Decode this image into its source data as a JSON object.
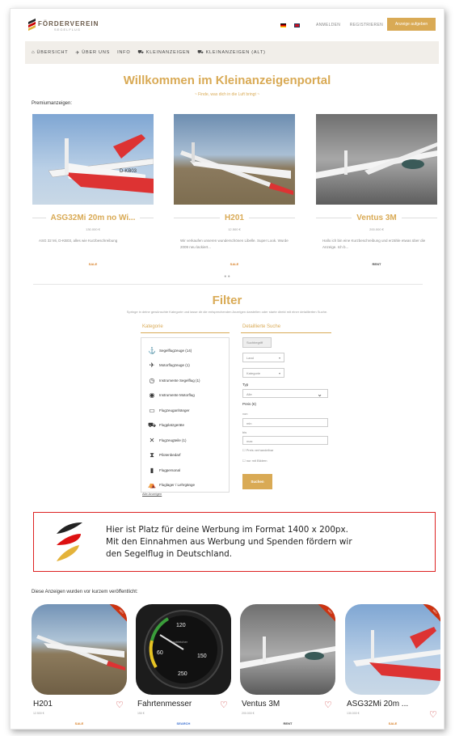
{
  "header": {
    "logo_text": "FÖRDERVEREIN",
    "logo_sub": "SEGELFLUG",
    "login": "ANMELDEN",
    "register": "REGISTRIEREN",
    "cta": "Anzeige aufgeben"
  },
  "nav": [
    {
      "label": "ÜBERSICHT",
      "icon": "home-icon"
    },
    {
      "label": "ÜBER UNS",
      "icon": "plane-icon"
    },
    {
      "label": "INFO",
      "icon": ""
    },
    {
      "label": "KLEINANZEIGEN",
      "icon": "cart-icon"
    },
    {
      "label": "KLEINANZEIGEN (ALT)",
      "icon": "cart-icon"
    }
  ],
  "welcome": {
    "title": "Willkommen im Kleinanzeigenportal",
    "subtitle": "~ Finde, was dich in die Luft bringt ~"
  },
  "premium": {
    "label": "Premiumanzeigen:",
    "cards": [
      {
        "title": "ASG32Mi 20m no Wi...",
        "price": "130.000 €",
        "desc": "ASG 32 Mi, D-KB03, alles wie Kurzbeschreibung",
        "tag": "SALE",
        "tag_color": "#d9822b"
      },
      {
        "title": "H201",
        "price": "12.500 €",
        "desc": "Wir verkaufen unseren wunderschönen Libelle. Super Look. Wurde 2009 neu lackiert...",
        "tag": "SALE",
        "tag_color": "#d9822b"
      },
      {
        "title": "Ventus 3M",
        "price": "200.000 €",
        "desc": "Hallo ich bin eine Kurzbeschreibung und erzähle etwas über die Anzeige. Ich b...",
        "tag": "RENT",
        "tag_color": "#444444"
      }
    ],
    "dots": "● ●"
  },
  "filter": {
    "title": "Filter",
    "description": "Springe in deine gewünschte Kategorie und lasse dir die entsprechenden Anzeigen darstellen oder starte direkt mit einer detaillierten Suche.",
    "category_head": "Kategorie",
    "search_head": "Detaillierte Suche",
    "categories": [
      {
        "label": "Segelflugzeuge (14)",
        "icon": "glider-icon",
        "glyph": "⚓"
      },
      {
        "label": "Motorflugzeuge (1)",
        "icon": "motorplane-icon",
        "glyph": "✈"
      },
      {
        "label": "Instrumente Segelflug (1)",
        "icon": "instrument-icon",
        "glyph": "◷"
      },
      {
        "label": "Instrumente Motorflug",
        "icon": "gauge-icon",
        "glyph": "◉"
      },
      {
        "label": "Flugzeuganhänger",
        "icon": "trailer-icon",
        "glyph": "▭"
      },
      {
        "label": "Flugplatzgeräte",
        "icon": "vehicle-icon",
        "glyph": "⛟"
      },
      {
        "label": "Flugzeugteile (1)",
        "icon": "tools-icon",
        "glyph": "✕"
      },
      {
        "label": "Pilotenbedarf",
        "icon": "parachute-icon",
        "glyph": "⧗"
      },
      {
        "label": "Flugpersonal",
        "icon": "person-icon",
        "glyph": "▮"
      },
      {
        "label": "Fluglager / Lehrgänge",
        "icon": "camp-icon",
        "glyph": "⛺"
      }
    ],
    "all_categories": "Alle Anzeigen",
    "search_placeholder": "Suchbegriff",
    "land": "Land",
    "kategorie": "Kategorie",
    "type_label": "Typ",
    "type_value": "Alle",
    "price_label": "Preis (€)",
    "from_label": "von",
    "from_value": "min",
    "to_label": "bis",
    "to_value": "max",
    "note_vhb": "☐ Preis verhandelbar",
    "note_images": "☐ nur mit Bildern",
    "search_button": "Suchen"
  },
  "ad": {
    "text1": "Hier ist Platz für deine Werbung im Format 1400 x 200px.",
    "text2": "Mit den Einnahmen aus Werbung und Spenden fördern wir",
    "text3": "den Segelflug in Deutschland."
  },
  "recent": {
    "label": "Diese Anzeigen wurden vor kurzem veröffentlicht:",
    "ribbon": "NEU",
    "cards": [
      {
        "title": "H201",
        "price": "12.500 €",
        "tag": "SALE",
        "tag_color": "#d9822b"
      },
      {
        "title": "Fahrtenmesser",
        "price": "150 €",
        "tag": "SEARCH",
        "tag_color": "#3a6fd0"
      },
      {
        "title": "Ventus 3M",
        "price": "200.000 €",
        "tag": "RENT",
        "tag_color": "#444444"
      },
      {
        "title": "ASG32Mi 20m ...",
        "price": "130.000 €",
        "tag": "SALE",
        "tag_color": "#d9822b"
      }
    ],
    "gauge_top": "120",
    "gauge_mid": "schleicher",
    "gauge_left": "60",
    "gauge_bottom": "250",
    "gauge_right": "150"
  }
}
